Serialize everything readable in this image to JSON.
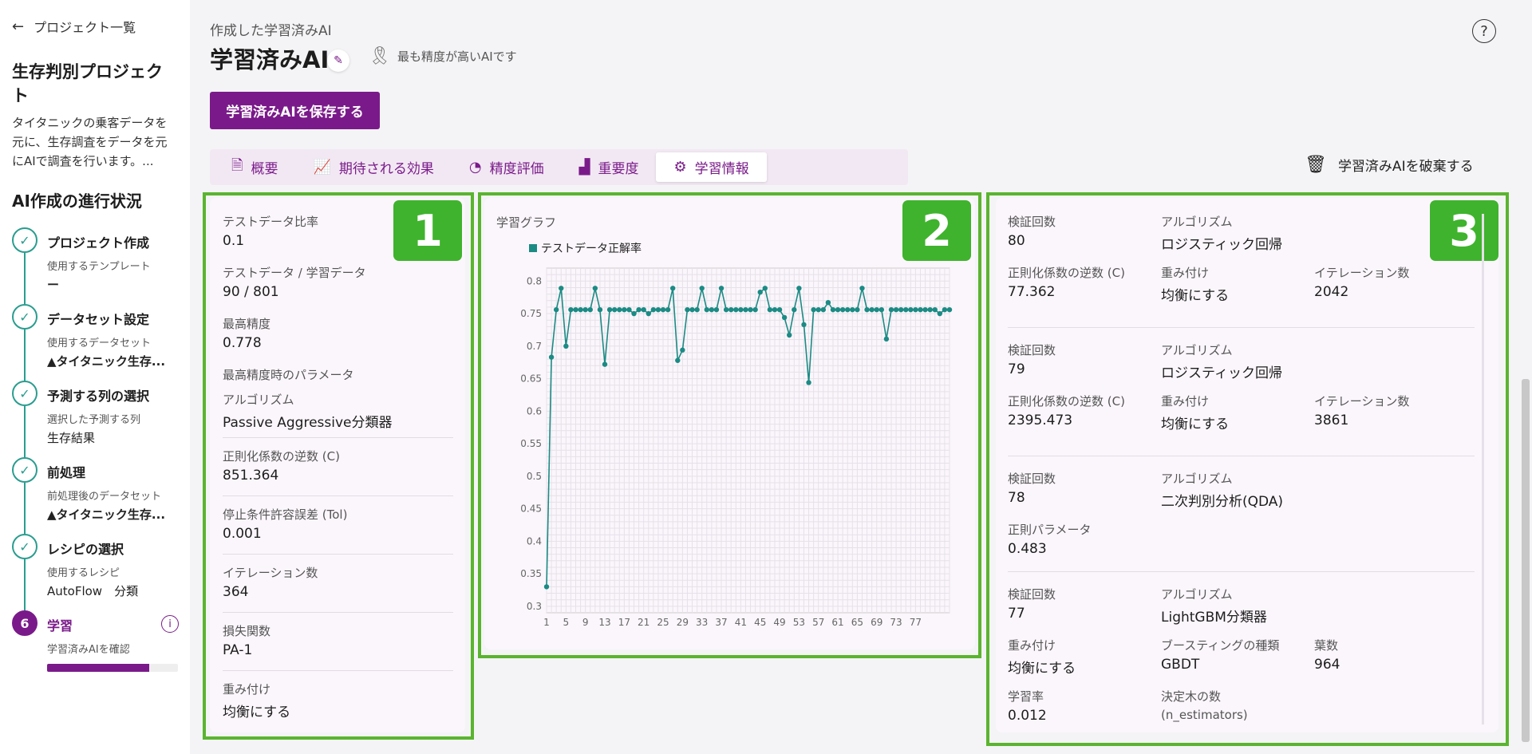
{
  "sidebar": {
    "back_label": "プロジェクト一覧",
    "project_title": "生存判別プロジェクト",
    "project_desc": "タイタニックの乗客データを元に、生存調査をデータを元にAIで調査を行います。...",
    "progress_heading": "AI作成の進行状況",
    "steps": [
      {
        "name": "プロジェクト作成",
        "sub": "使用するテンプレート",
        "value": "ー"
      },
      {
        "name": "データセット設定",
        "sub": "使用するデータセット",
        "value": "▲タイタニック生存..."
      },
      {
        "name": "予測する列の選択",
        "sub": "選択した予測する列",
        "value": "生存結果"
      },
      {
        "name": "前処理",
        "sub": "前処理後のデータセット",
        "value": "▲タイタニック生存..."
      },
      {
        "name": "レシピの選択",
        "sub": "使用するレシピ",
        "value": "AutoFlow　分類"
      },
      {
        "number": "6",
        "name": "学習",
        "sub": "学習済みAIを確認",
        "progress": 0.78
      }
    ],
    "check_icon": "✓",
    "info_icon": "i"
  },
  "header": {
    "subtitle": "作成した学習済みAI",
    "title": "学習済みAI",
    "best_badge": "最も精度が高いAIです",
    "save_button": "学習済みAIを保存する",
    "help_icon": "?"
  },
  "tabs": [
    {
      "label": "概要",
      "icon": "document-icon"
    },
    {
      "label": "期待される効果",
      "icon": "line-chart-icon"
    },
    {
      "label": "精度評価",
      "icon": "gauge-icon"
    },
    {
      "label": "重要度",
      "icon": "podium-icon"
    },
    {
      "label": "学習情報",
      "icon": "gear-icon",
      "active": true
    }
  ],
  "discard_button": "学習済みAIを破棄する",
  "badges": [
    "1",
    "2",
    "3"
  ],
  "panel1": {
    "test_ratio_label": "テストデータ比率",
    "test_ratio": "0.1",
    "test_train_label": "テストデータ / 学習データ",
    "test_train": "90 / 801",
    "best_acc_label": "最高精度",
    "best_acc": "0.778",
    "best_params_label": "最高精度時のパラメータ",
    "algo_label": "アルゴリズム",
    "algo": "Passive Aggressive分類器",
    "c_label": "正則化係数の逆数 (C)",
    "c": "851.364",
    "tol_label": "停止条件許容誤差 (Tol)",
    "tol": "0.001",
    "iter_label": "イテレーション数",
    "iter": "364",
    "loss_label": "損失関数",
    "loss": "PA-1",
    "weight_label": "重み付け",
    "weight": "均衡にする"
  },
  "panel2": {
    "title": "学習グラフ"
  },
  "chart_data": {
    "type": "line",
    "series": [
      {
        "name": "テストデータ正解率",
        "values": [
          0.33,
          0.683,
          0.756,
          0.789,
          0.7,
          0.756,
          0.756,
          0.756,
          0.756,
          0.756,
          0.789,
          0.756,
          0.672,
          0.756,
          0.756,
          0.756,
          0.756,
          0.756,
          0.75,
          0.756,
          0.756,
          0.75,
          0.756,
          0.756,
          0.756,
          0.756,
          0.789,
          0.678,
          0.694,
          0.756,
          0.756,
          0.756,
          0.789,
          0.756,
          0.756,
          0.756,
          0.789,
          0.756,
          0.756,
          0.756,
          0.756,
          0.756,
          0.756,
          0.756,
          0.783,
          0.789,
          0.756,
          0.756,
          0.756,
          0.744,
          0.717,
          0.756,
          0.789,
          0.733,
          0.644,
          0.756,
          0.756,
          0.756,
          0.767,
          0.756,
          0.756,
          0.756,
          0.756,
          0.756,
          0.756,
          0.789,
          0.756,
          0.756,
          0.756,
          0.756,
          0.711,
          0.756,
          0.756,
          0.756,
          0.756,
          0.756,
          0.756,
          0.756,
          0.756,
          0.756,
          0.756,
          0.75,
          0.756,
          0.756
        ]
      }
    ],
    "x_ticks": [
      "1",
      "5",
      "9",
      "13",
      "17",
      "21",
      "25",
      "29",
      "33",
      "37",
      "41",
      "45",
      "49",
      "53",
      "57",
      "61",
      "65",
      "69",
      "73",
      "77"
    ],
    "y_ticks": [
      "0.8",
      "0.75",
      "0.7",
      "0.65",
      "0.6",
      "0.55",
      "0.5",
      "0.45",
      "0.4",
      "0.35",
      "0.3"
    ],
    "ylim": [
      0.29,
      0.82
    ],
    "grid": true,
    "legend": "top-left",
    "color": "#1b8b84"
  },
  "panel3": {
    "records": [
      {
        "count_label": "検証回数",
        "count": "80",
        "algo_label": "アルゴリズム",
        "algo": "ロジスティック回帰",
        "row2": [
          {
            "label": "正則化係数の逆数 (C)",
            "value": "77.362"
          },
          {
            "label": "重み付け",
            "value": "均衡にする"
          },
          {
            "label": "イテレーション数",
            "value": "2042"
          }
        ]
      },
      {
        "count_label": "検証回数",
        "count": "79",
        "algo_label": "アルゴリズム",
        "algo": "ロジスティック回帰",
        "row2": [
          {
            "label": "正則化係数の逆数 (C)",
            "value": "2395.473"
          },
          {
            "label": "重み付け",
            "value": "均衡にする"
          },
          {
            "label": "イテレーション数",
            "value": "3861"
          }
        ]
      },
      {
        "count_label": "検証回数",
        "count": "78",
        "algo_label": "アルゴリズム",
        "algo": "二次判別分析(QDA)",
        "row2": [
          {
            "label": "正則パラメータ",
            "value": "0.483"
          }
        ]
      },
      {
        "count_label": "検証回数",
        "count": "77",
        "algo_label": "アルゴリズム",
        "algo": "LightGBM分類器",
        "row2": [
          {
            "label": "重み付け",
            "value": "均衡にする"
          },
          {
            "label": "ブースティングの種類",
            "value": "GBDT"
          },
          {
            "label": "葉数",
            "value": "964"
          }
        ],
        "row3": [
          {
            "label": "学習率",
            "value": "0.012"
          },
          {
            "label": "決定木の数",
            "value": "(n_estimators)"
          }
        ]
      }
    ]
  },
  "colors": {
    "accent": "#7a1a8a",
    "teal": "#2a9d8f",
    "green_badge": "#3fb32d"
  }
}
